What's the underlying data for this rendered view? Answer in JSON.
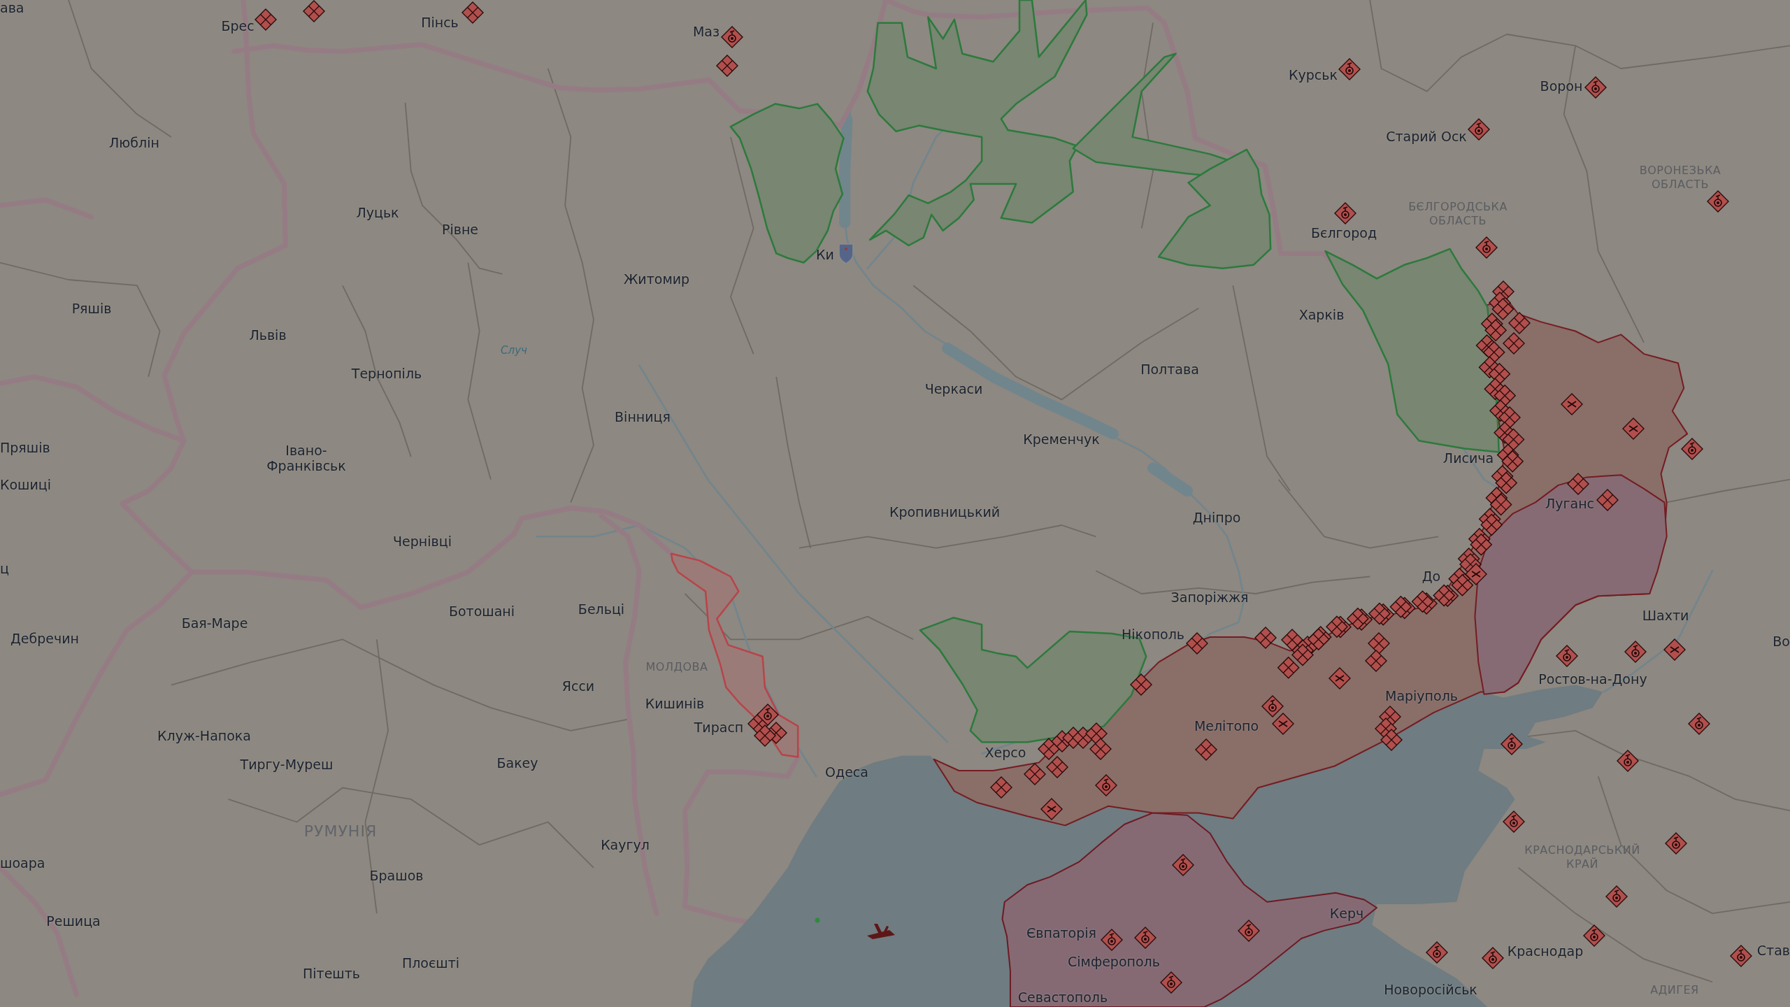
{
  "map": {
    "city_labels": [
      "ава",
      "Брес",
      "Пінсь",
      "Маз",
      "Курськ",
      "Ворон",
      "Люблін",
      "Старий Оск",
      "Луцьк",
      "Рівне",
      "Бєлгород",
      "Ки",
      "Житомир",
      "Ряшів",
      "Харків",
      "Львів",
      "Тернопіль",
      "Черкаси",
      "Полтава",
      "Вінниця",
      "Пряшів",
      "Івано-Франківськ",
      "Кременчук",
      "Лисича",
      "Кошиці",
      "Кропивницький",
      "Дніпро",
      "Луганс",
      "Чернівці",
      "ц",
      "До",
      "Дебречин",
      "Бая-Маре",
      "Ботошані",
      "Бельці",
      "Нікополь",
      "Запоріжжя",
      "Шахти",
      "Во",
      "Ясси",
      "Кишинів",
      "Маріуполь",
      "Ростов-на-Дону",
      "Клуж-Напока",
      "Тирасп",
      "Мелітопо",
      "Тиргу-Муреш",
      "Бакеу",
      "Одеса",
      "Херсо",
      "Каугул",
      "шоара",
      "Брашов",
      "Решица",
      "Євпаторія",
      "Керч",
      "Пітешть",
      "Плоєшті",
      "Сімферополь",
      "Краснодар",
      "Став",
      "Севастополь",
      "Новоросійськ"
    ],
    "area_labels": [
      {
        "kind": "region",
        "text": "ВОРОНЕЗЬКА ОБЛАСТЬ"
      },
      {
        "kind": "region",
        "text": "БЄЛГОРОДСЬКА ОБЛАСТЬ"
      },
      {
        "kind": "river",
        "text": "Случ"
      },
      {
        "kind": "region",
        "text": "МОЛДОВА"
      },
      {
        "kind": "country",
        "text": "РУМУНІЯ"
      },
      {
        "kind": "region",
        "text": "КРАСНОДАРСЬКИЙ КРАЙ"
      },
      {
        "kind": "region",
        "text": "АДИГЕЯ"
      }
    ]
  }
}
